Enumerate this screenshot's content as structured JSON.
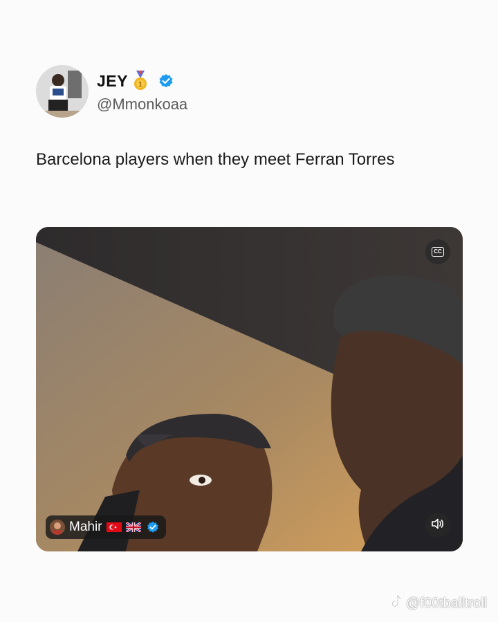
{
  "post": {
    "display_name": "JEY",
    "handle": "@Mmonkoaa",
    "text": "Barcelona players when they meet Ferran Torres",
    "verified_color": "#1d9bf0"
  },
  "media": {
    "overlay_user": "Mahir",
    "overlay_flags": [
      "turkey-flag",
      "uk-flag"
    ],
    "cc_label": "CC",
    "icons": [
      "cc-icon",
      "speaker-icon"
    ]
  },
  "watermark": {
    "text": "@f00tballtroll",
    "icon": "tiktok-icon"
  }
}
